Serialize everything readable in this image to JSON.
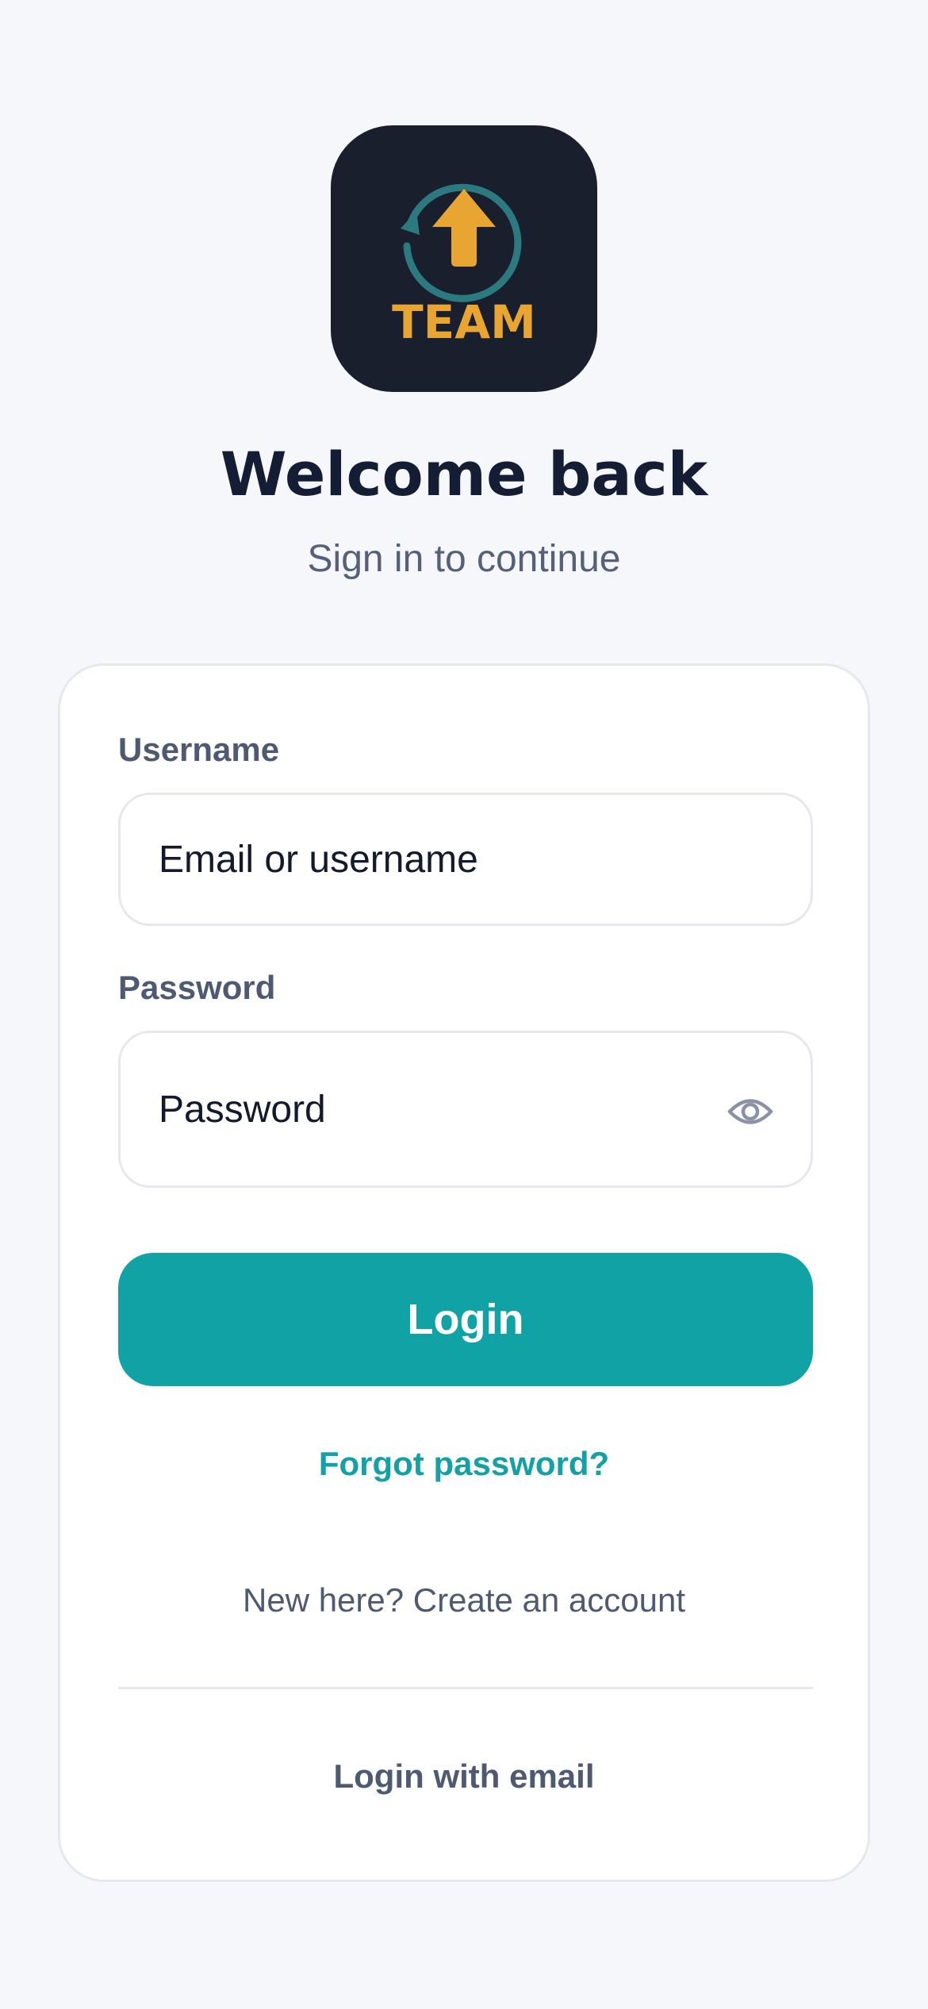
{
  "logo": {
    "text": "TEAM",
    "colors": {
      "background": "#1a1f2d",
      "arrow": "#e8a532",
      "ring": "#2a7a80"
    }
  },
  "header": {
    "title": "Welcome back",
    "subtitle": "Sign in to continue"
  },
  "form": {
    "username": {
      "label": "Username",
      "placeholder": "Email or username",
      "value": ""
    },
    "password": {
      "label": "Password",
      "placeholder": "Password",
      "value": "",
      "toggle_icon": "eye-icon"
    },
    "login_label": "Login",
    "forgot_label": "Forgot password?",
    "create_label": "New here? Create an account",
    "email_login_label": "Login with email"
  },
  "colors": {
    "accent": "#11a2a6",
    "page_background": "#f5f7fb",
    "title": "#141d34",
    "muted": "#566179"
  }
}
